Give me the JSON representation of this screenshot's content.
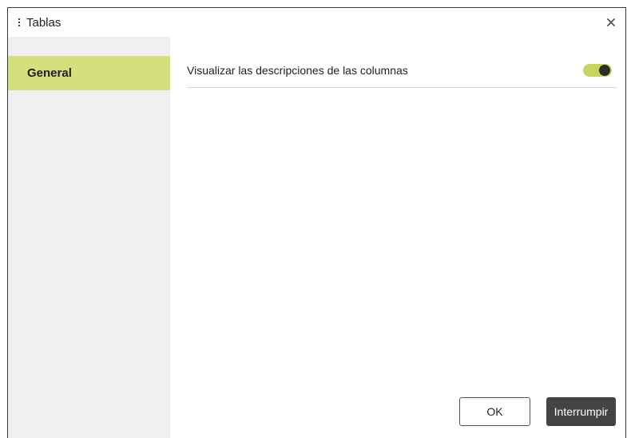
{
  "dialog": {
    "title": "Tablas",
    "drag_icon": "vertical-ellipsis-icon",
    "close_icon": "close-icon"
  },
  "sidebar": {
    "items": [
      {
        "label": "General",
        "selected": true
      }
    ]
  },
  "settings": [
    {
      "label": "Visualizar las descripciones de las columnas",
      "enabled": true
    }
  ],
  "buttons": {
    "ok_label": "OK",
    "cancel_label": "Interrumpir"
  },
  "colors": {
    "accent": "#d5df7d",
    "toggle_on": "#c7d45e",
    "sidebar_bg": "#f0f0f0",
    "dark_button": "#444444"
  }
}
